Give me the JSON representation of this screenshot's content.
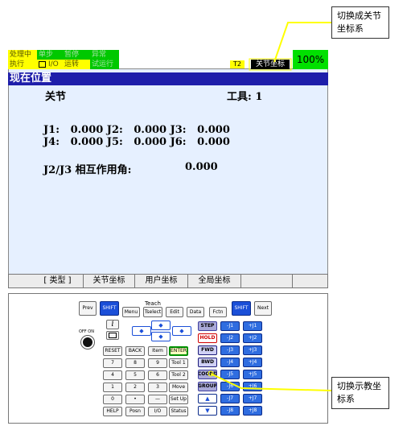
{
  "status_bar": {
    "row1": [
      "处理中",
      "单步",
      "暂停",
      "异常"
    ],
    "row2": [
      "执行",
      "I/O",
      "运转",
      "试运行"
    ],
    "tool": "T2",
    "coord_mode": "关节坐标",
    "override": "100%"
  },
  "screen": {
    "title": "现在位置",
    "mode_label": "关节",
    "tool_label": "工具: 1",
    "joints_row1": "J1:   0.000 J2:   0.000 J3:   0.000",
    "joints_row2": "J4:   0.000 J5:   0.000 J6:   0.000",
    "interaction_label": "J2/J3 相互作用角:",
    "interaction_value": "0.000"
  },
  "function_keys": [
    "[ 类型 ]",
    "关节坐标",
    "用户坐标",
    "全局坐标",
    ""
  ],
  "pendant": {
    "teach": "Teach",
    "keys": {
      "prev": "Prev",
      "shift": "SHIFT",
      "menu": "Menu",
      "tselect": "Tselect",
      "edit": "Edit",
      "data": "Data",
      "fctn": "Fctn",
      "next": "Next",
      "info": "i",
      "off_on": "OFF  ON",
      "reset": "RESET",
      "back": "BACK",
      "item": "Item",
      "enter": "ENTER",
      "n7": "7",
      "n8": "8",
      "n9": "9",
      "tool1": "Tool 1",
      "n4": "4",
      "n5": "5",
      "n6": "6",
      "tool2": "Tool 2",
      "n1": "1",
      "n2": "2",
      "n3": "3",
      "move": "Move",
      "n0": "0",
      "dot": "•",
      "minus": "—",
      "setup": "Set Up",
      "help": "HELP",
      "posn": "Posn",
      "io": "I/O",
      "status": "Status",
      "step": "STEP",
      "hold": "HOLD",
      "fwd": "FWD",
      "bwd": "BWD",
      "coord": "COORD",
      "group": "GROUP"
    },
    "jog_minus": [
      "-J1",
      "-J2",
      "-J3",
      "-J4",
      "-J5",
      "-J6",
      "-J7",
      "-J8"
    ],
    "jog_plus": [
      "+J1",
      "+J2",
      "+J3",
      "+J4",
      "+J5",
      "+J6",
      "+J7",
      "+J8"
    ]
  },
  "callouts": {
    "top": "切换成关节坐标系",
    "bottom": "切换示教坐标系"
  },
  "colors": {
    "status_yellow": "#ffff00",
    "status_green": "#00c800",
    "title_bar": "#1e1eaa",
    "screen_bg": "#e6f0ff",
    "key_blue": "#1b4fd8",
    "callout_line": "#ffff00"
  }
}
